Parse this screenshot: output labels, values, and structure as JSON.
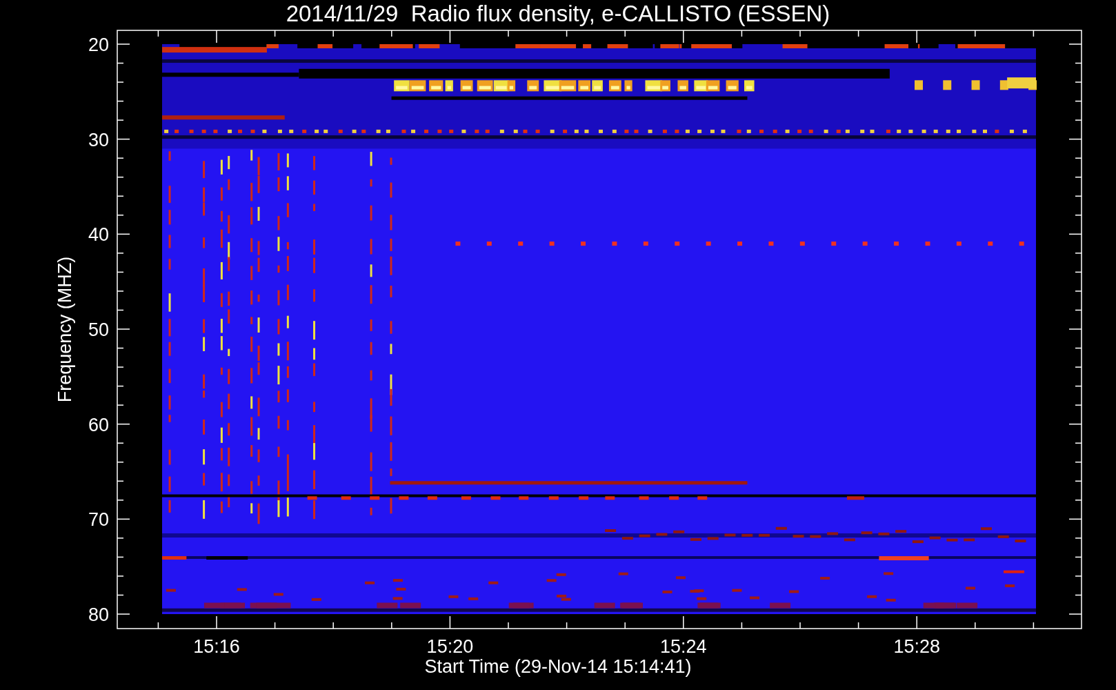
{
  "title": "2014/11/29  Radio flux density, e-CALLISTO (ESSEN)",
  "y_axis": {
    "label": "Frequency (MHZ)",
    "ticks": [
      "20",
      "30",
      "40",
      "50",
      "60",
      "70",
      "80"
    ]
  },
  "x_axis": {
    "label": "Start Time (29-Nov-14 15:14:41)",
    "ticks": [
      "15:16",
      "15:20",
      "15:24",
      "15:28"
    ]
  }
}
